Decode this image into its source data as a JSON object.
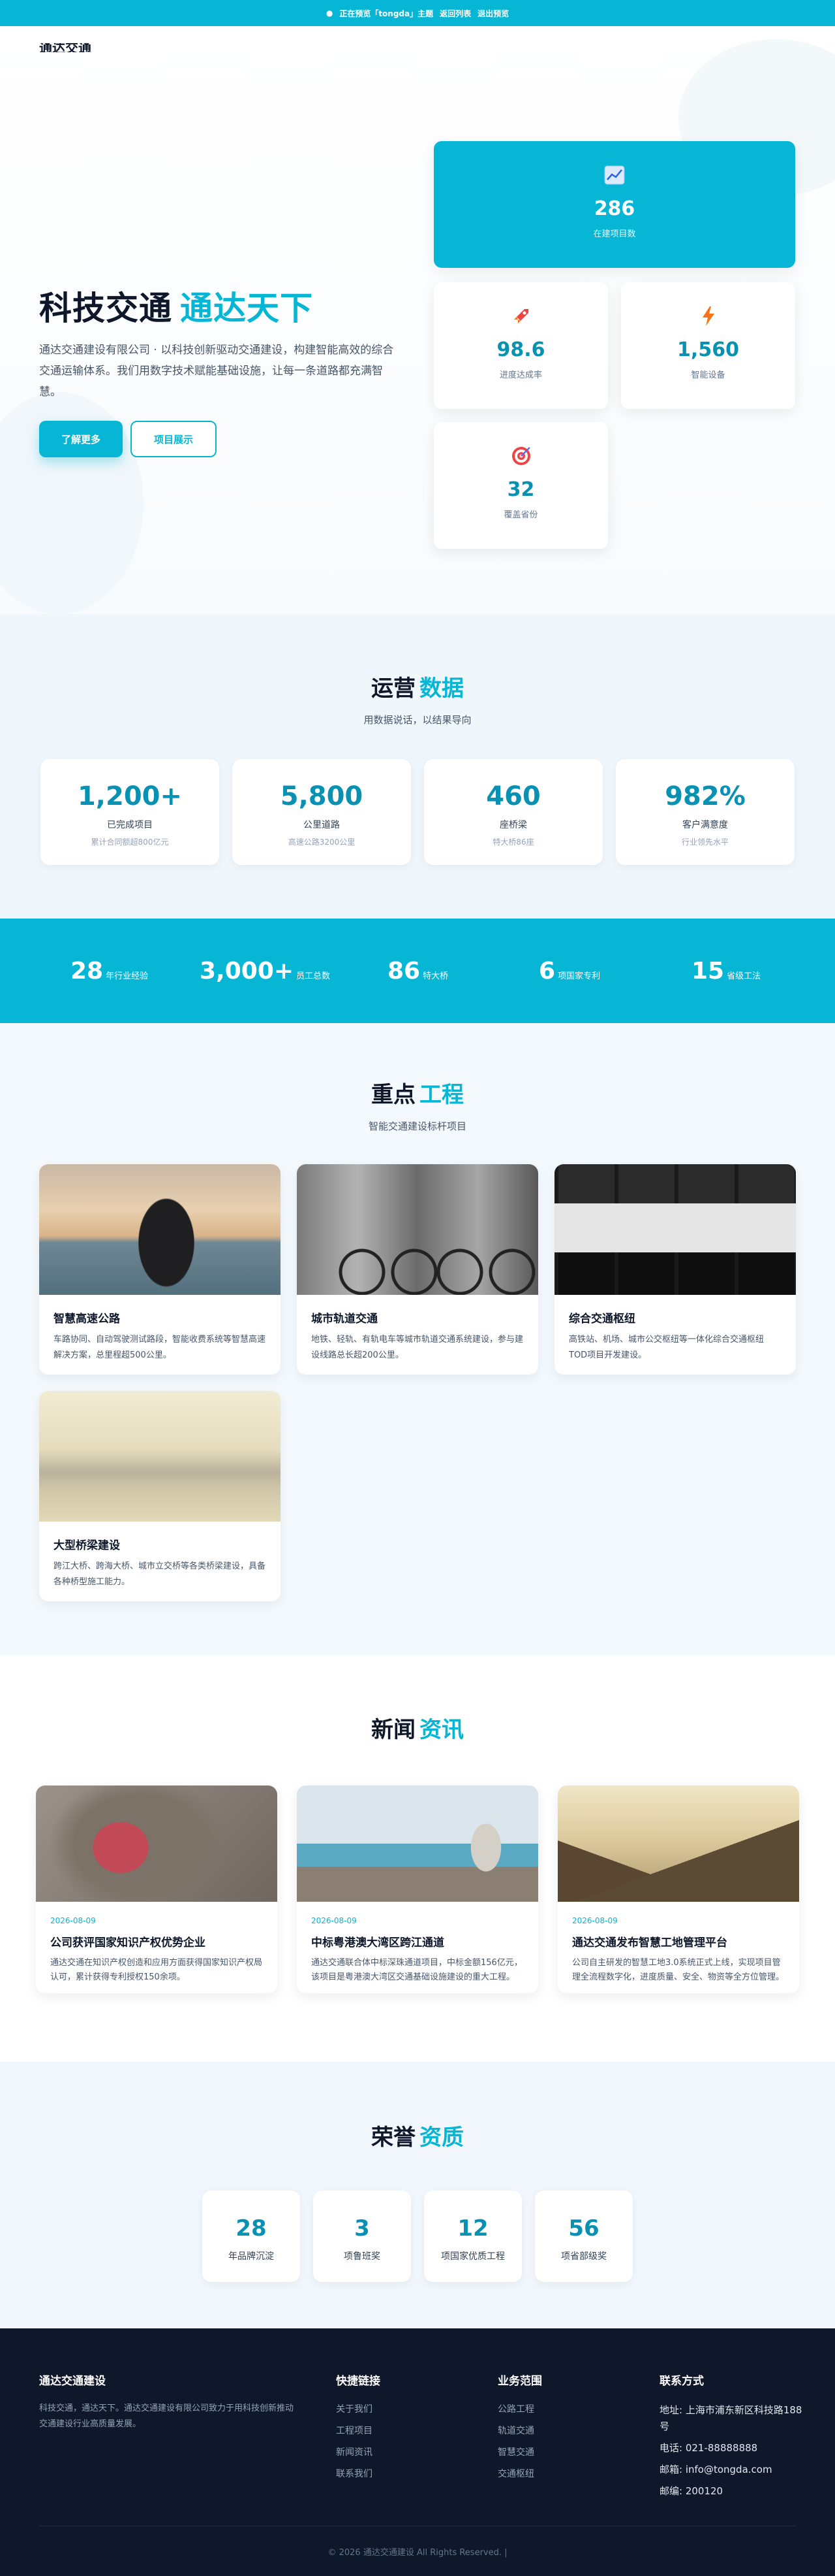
{
  "topbar": {
    "dot": "●",
    "notice": "正在预览「tongda」主题",
    "link1": "返回列表",
    "link2": "退出预览"
  },
  "header": {
    "logo_partial": "通达交通"
  },
  "hero": {
    "title_main": "科技交通",
    "title_accent": "通达天下",
    "desc": "通达交通建设有限公司 · 以科技创新驱动交通建设，构建智能高效的综合交通运输体系。我们用数字技术赋能基础设施，让每一条道路都充满智慧。",
    "btn_primary": "了解更多",
    "btn_secondary": "项目展示",
    "stats": [
      {
        "icon": "chart-icon",
        "num": "286",
        "label": "在建项目数"
      },
      {
        "icon": "rocket-icon",
        "num": "98.6",
        "label": "进度达成率"
      },
      {
        "icon": "bolt-icon",
        "num": "1,560",
        "label": "智能设备"
      },
      {
        "icon": "target-icon",
        "num": "32",
        "label": "覆盖省份"
      }
    ]
  },
  "ops": {
    "title_main": "运营",
    "title_accent": "数据",
    "subtitle": "用数据说话，以结果导向",
    "cards": [
      {
        "num": "1,200+",
        "title": "已完成项目",
        "sub": "累计合同额超800亿元"
      },
      {
        "num": "5,800",
        "title": "公里道路",
        "sub": "高速公路3200公里"
      },
      {
        "num": "460",
        "title": "座桥梁",
        "sub": "特大桥86座"
      },
      {
        "num": "982%",
        "title": "客户满意度",
        "sub": "行业领先水平"
      }
    ]
  },
  "band": [
    {
      "num": "28",
      "label": "年行业经验"
    },
    {
      "num": "3,000+",
      "label": "员工总数"
    },
    {
      "num": "86",
      "label": "特大桥"
    },
    {
      "num": "6",
      "label": "项国家专利"
    },
    {
      "num": "15",
      "label": "省级工法"
    }
  ],
  "projects": {
    "title_main": "重点",
    "title_accent": "工程",
    "subtitle": "智能交通建设标杆项目",
    "items": [
      {
        "title": "智慧高速公路",
        "desc": "车路协同、自动驾驶测试路段，智能收费系统等智慧高速解决方案，总里程超500公里。"
      },
      {
        "title": "城市轨道交通",
        "desc": "地铁、轻轨、有轨电车等城市轨道交通系统建设，参与建设线路总长超200公里。"
      },
      {
        "title": "综合交通枢纽",
        "desc": "高铁站、机场、城市公交枢纽等一体化综合交通枢纽TOD项目开发建设。"
      },
      {
        "title": "大型桥梁建设",
        "desc": "跨江大桥、跨海大桥、城市立交桥等各类桥梁建设，具备各种桥型施工能力。"
      }
    ]
  },
  "news": {
    "title_main": "新闻",
    "title_accent": "资讯",
    "items": [
      {
        "date": "2026-08-09",
        "title": "公司获评国家知识产权优势企业",
        "desc": "通达交通在知识产权创造和应用方面获得国家知识产权局认可，累计获得专利授权150余项。"
      },
      {
        "date": "2026-08-09",
        "title": "中标粤港澳大湾区跨江通道",
        "desc": "通达交通联合体中标深珠通道项目，中标金额156亿元，该项目是粤港澳大湾区交通基础设施建设的重大工程。"
      },
      {
        "date": "2026-08-09",
        "title": "通达交通发布智慧工地管理平台",
        "desc": "公司自主研发的智慧工地3.0系统正式上线，实现项目管理全流程数字化，进度质量、安全、物资等全方位管理。"
      }
    ]
  },
  "honors": {
    "title_main": "荣誉",
    "title_accent": "资质",
    "items": [
      {
        "num": "28",
        "label": "年品牌沉淀"
      },
      {
        "num": "3",
        "label": "项鲁班奖"
      },
      {
        "num": "12",
        "label": "项国家优质工程"
      },
      {
        "num": "56",
        "label": "项省部级奖"
      }
    ]
  },
  "footer": {
    "about_title": "通达交通建设",
    "about_text": "科技交通，通达天下。通达交通建设有限公司致力于用科技创新推动交通建设行业高质量发展。",
    "links_title": "快捷链接",
    "links": [
      "关于我们",
      "工程项目",
      "新闻资讯",
      "联系我们"
    ],
    "biz_title": "业务范围",
    "biz": [
      "公路工程",
      "轨道交通",
      "智慧交通",
      "交通枢纽"
    ],
    "contact_title": "联系方式",
    "contact": [
      "地址: 上海市浦东新区科技路188号",
      "电话: 021-88888888",
      "邮箱: info@tongda.com",
      "邮编: 200120"
    ],
    "copyright": "© 2026 通达交通建设 All Rights Reserved. |"
  }
}
